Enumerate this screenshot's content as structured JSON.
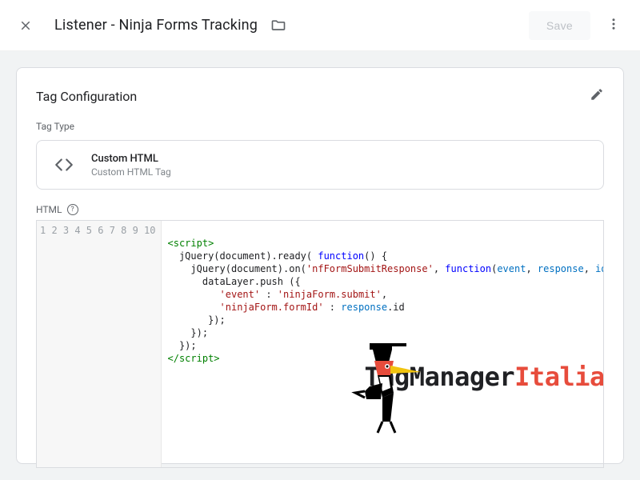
{
  "header": {
    "title": "Listener - Ninja Forms Tracking",
    "save_label": "Save"
  },
  "card": {
    "title": "Tag Configuration",
    "tag_type_label": "Tag Type",
    "tag_type_name": "Custom HTML",
    "tag_type_sub": "Custom HTML Tag",
    "html_label": "HTML"
  },
  "code": {
    "line_numbers": [
      "1",
      "2",
      "3",
      "4",
      "5",
      "6",
      "7",
      "8",
      "9",
      "10"
    ],
    "l1_a": "<script>",
    "l2_a": "  jQuery(document).ready( ",
    "l2_b": "function",
    "l2_c": "() {",
    "l3_a": "    jQuery(document).on(",
    "l3_b": "'nfFormSubmitResponse'",
    "l3_c": ", ",
    "l3_d": "function",
    "l3_e": "(",
    "l3_f": "event",
    "l3_g": ", ",
    "l3_h": "response",
    "l3_i": ", ",
    "l3_j": "id",
    "l3_k": ") {",
    "l4_a": "      dataLayer.push ({",
    "l5_a": "         ",
    "l5_b": "'event'",
    "l5_c": " : ",
    "l5_d": "'ninjaForm.submit'",
    "l5_e": ",",
    "l6_a": "         ",
    "l6_b": "'ninjaForm.formId'",
    "l6_c": " : ",
    "l6_d": "response",
    "l6_e": ".id",
    "l7_a": "       });",
    "l8_a": "    });",
    "l9_a": "  });",
    "l10_a": "</script>"
  },
  "watermark": {
    "brand_a": "TagManager",
    "brand_b": "Italia"
  }
}
